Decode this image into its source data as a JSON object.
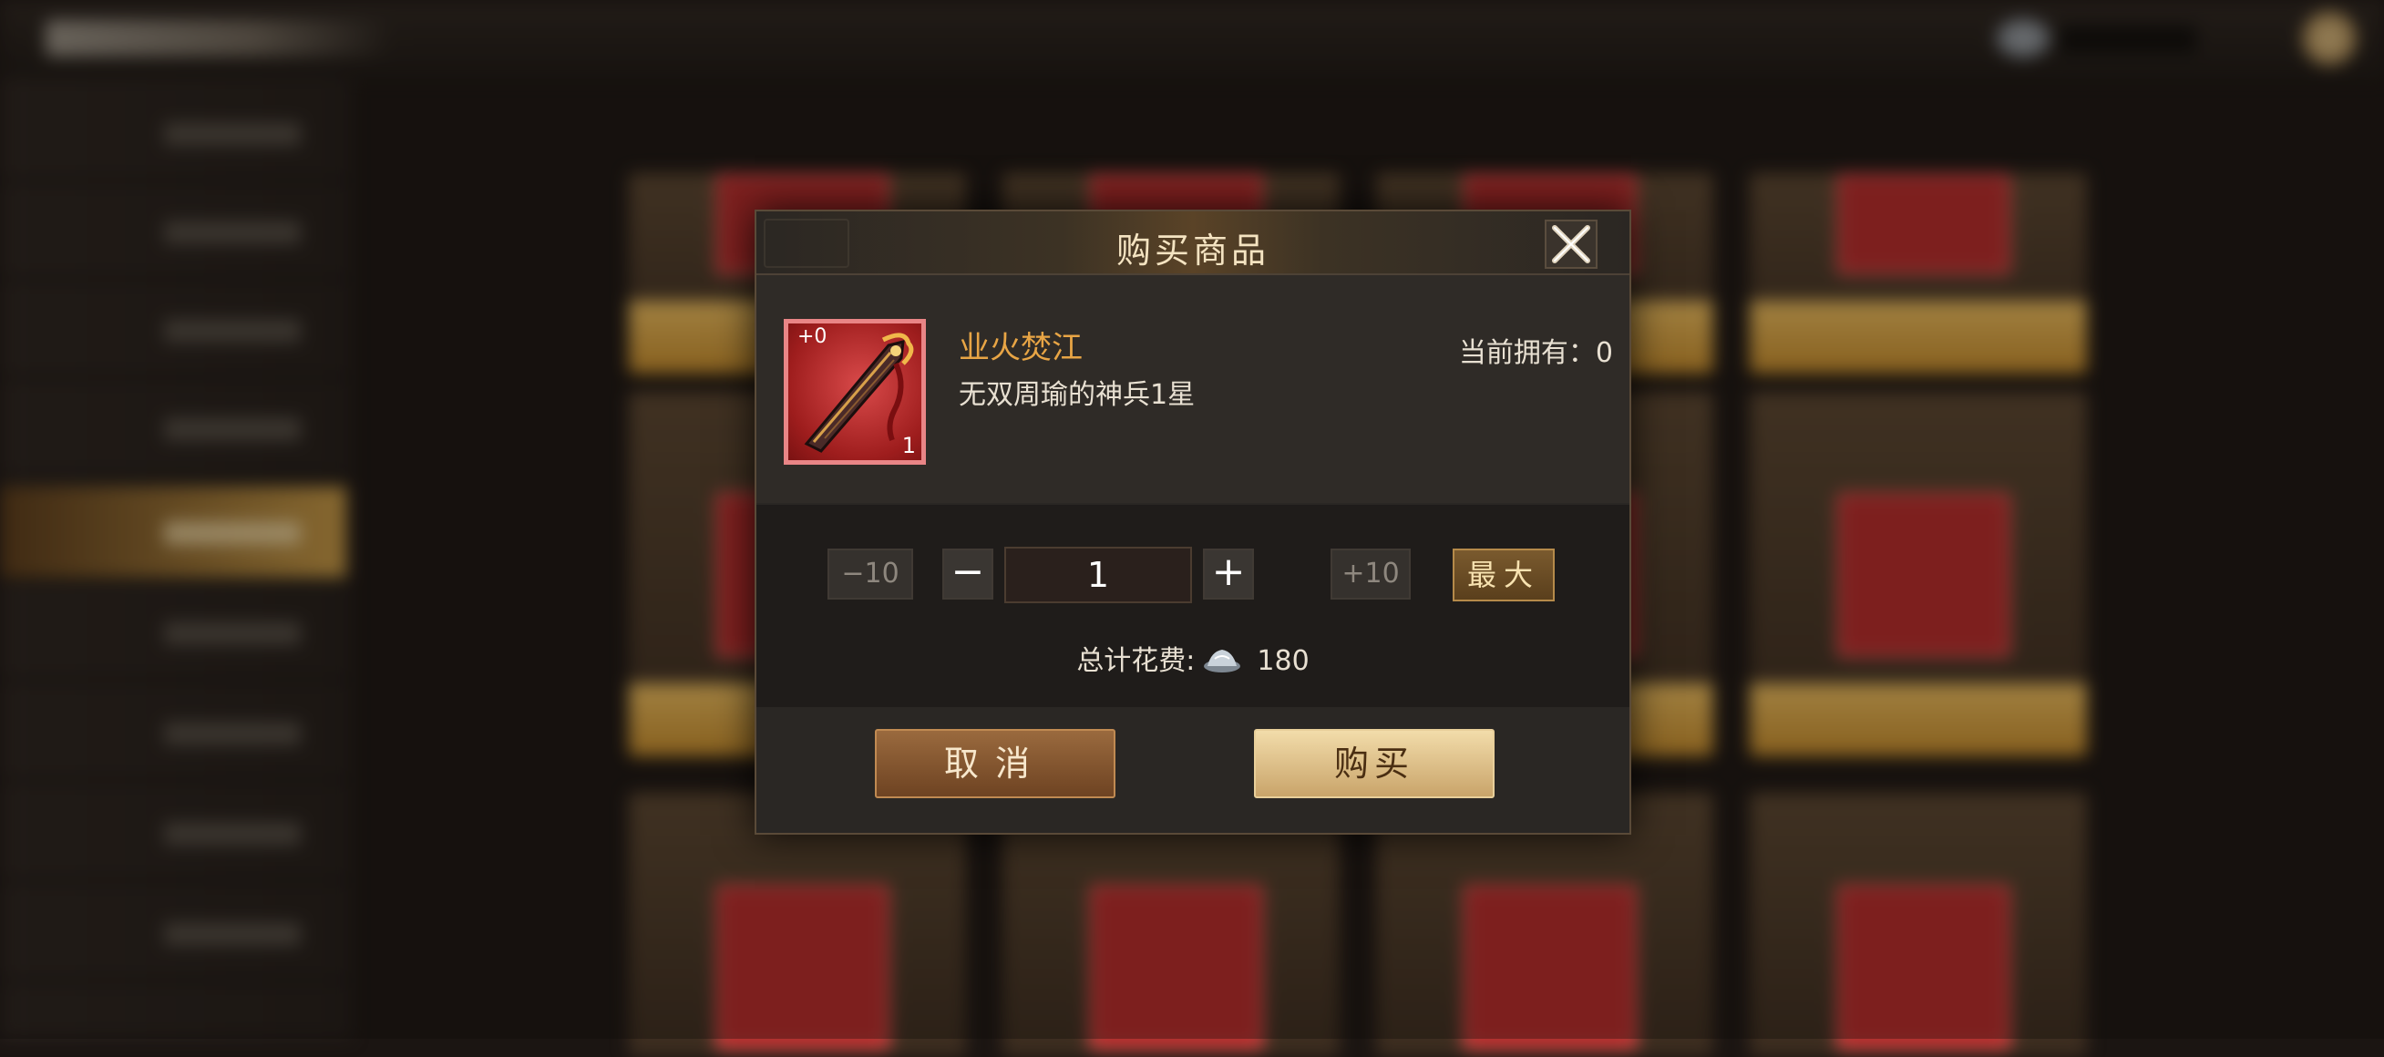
{
  "dialog": {
    "title": "购买商品",
    "item": {
      "name": "业火焚江",
      "description": "无双周瑜的神兵1星",
      "level_badge": "+0",
      "stack_count": "1",
      "owned_text": "当前拥有：0"
    },
    "quantity": {
      "minus10_label": "−10",
      "minus_label": "−",
      "value": "1",
      "plus_label": "+",
      "plus10_label": "+10",
      "max_label": "最大"
    },
    "cost": {
      "label": "总计花费:",
      "currency_icon": "silver-ingot-icon",
      "amount": "180"
    },
    "buttons": {
      "cancel": "取消",
      "buy": "购买"
    }
  },
  "colors": {
    "accent_gold": "#e8a545",
    "dialog_bg": "#2a2724",
    "item_frame_red": "#e98586"
  }
}
